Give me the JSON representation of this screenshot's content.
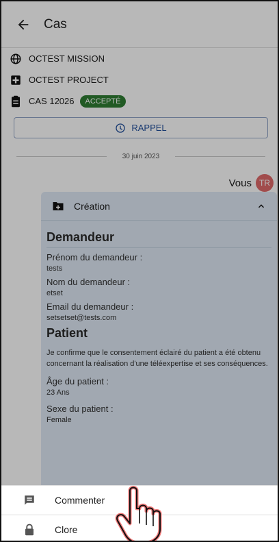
{
  "appbar": {
    "title": "Cas"
  },
  "info": {
    "mission": "OCTEST MISSION",
    "project": "OCTEST PROJECT",
    "case": "CAS 12026",
    "status": "ACCEPTÉ"
  },
  "rappel_label": "RAPPEL",
  "date_separator": "30 juin 2023",
  "sender": {
    "name": "Vous",
    "initials": "TR"
  },
  "card": {
    "title": "Création",
    "sections": {
      "demandeur": {
        "title": "Demandeur",
        "prenom_label": "Prénom du demandeur :",
        "prenom_value": "tests",
        "nom_label": "Nom du demandeur :",
        "nom_value": "etset",
        "email_label": "Email du demandeur :",
        "email_value": "setsetset@tests.com"
      },
      "patient": {
        "title": "Patient",
        "consent_text": "Je confirme que le consentement éclairé du patient a été obtenu concernant la réalisation d'une téléexpertise et ses conséquences.",
        "age_label": "Âge du patient :",
        "age_value": "23 Ans",
        "sexe_label": "Sexe du patient :",
        "sexe_value": "Female"
      }
    }
  },
  "sheet": {
    "comment": "Commenter",
    "close": "Clore"
  },
  "colors": {
    "status_green": "#2e7d32",
    "link_blue": "#1f4e9c",
    "avatar_red": "#e06a6a",
    "card_bg": "#dfe9f5"
  }
}
